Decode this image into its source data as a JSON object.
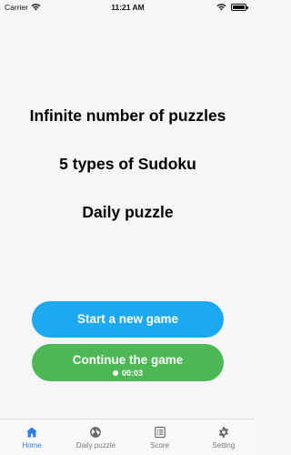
{
  "status_bar": {
    "carrier": "Carrier",
    "time": "11:21 AM"
  },
  "features": [
    "Infinite number of puzzles",
    "5 types of Sudoku",
    "Daily puzzle"
  ],
  "buttons": {
    "new_game": "Start a new game",
    "continue_game": "Continue the game",
    "continue_timer": "00:03"
  },
  "tab_bar": {
    "tabs": [
      {
        "label": "Home",
        "icon": "home-icon",
        "active": true
      },
      {
        "label": "Daily puzzle",
        "icon": "globe-icon",
        "active": false
      },
      {
        "label": "Score",
        "icon": "score-list-icon",
        "active": false
      },
      {
        "label": "Setting",
        "icon": "gear-icon",
        "active": false
      }
    ]
  },
  "colors": {
    "new_game_button": "#1da8f2",
    "continue_button": "#4fb856",
    "active_tab": "#2b7de9",
    "inactive_tab": "#777777",
    "background": "#f6f6f6"
  }
}
